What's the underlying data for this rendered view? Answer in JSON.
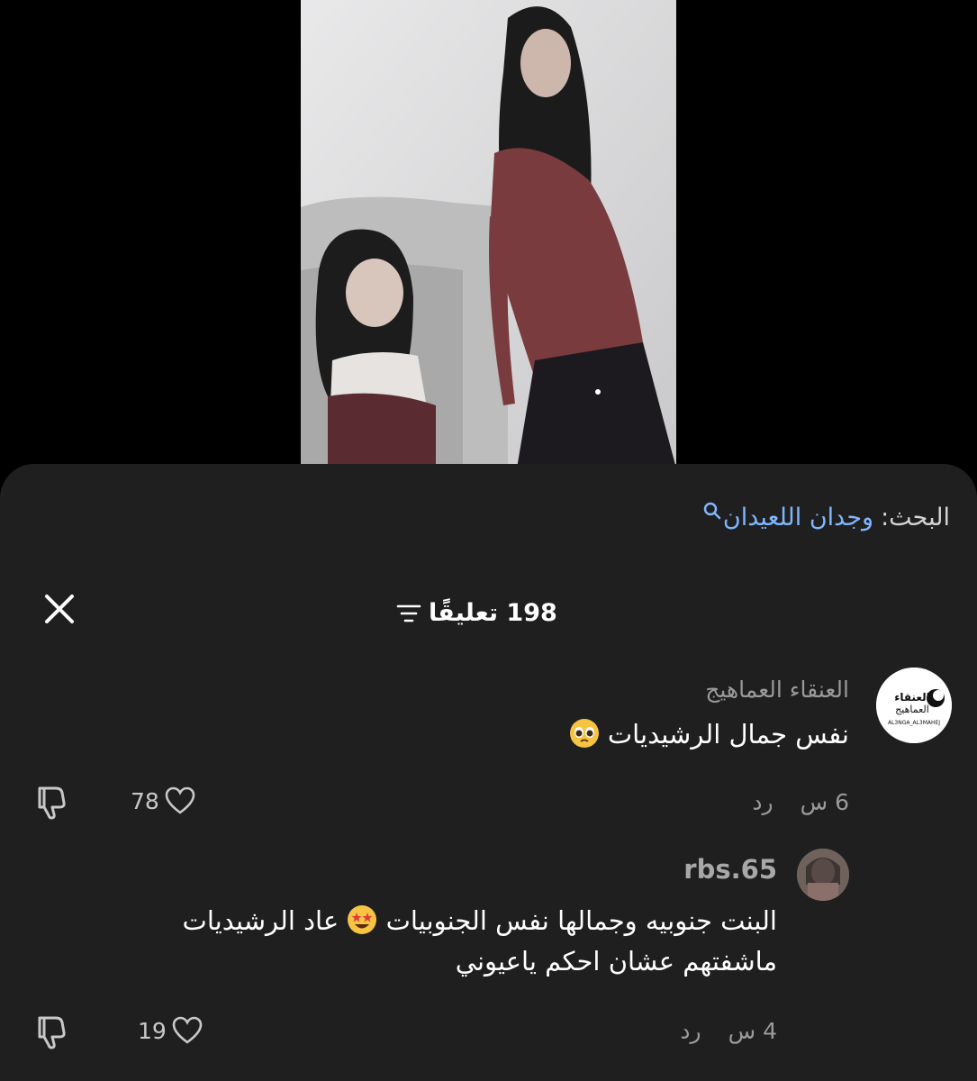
{
  "video": {
    "description_icon": "video-frame"
  },
  "search": {
    "prefix": "البحث:",
    "term": "وجدان اللعيدان",
    "icon": "search-icon"
  },
  "comments_header": {
    "count_label": "198 تعليقًا",
    "filter_icon": "filter-icon",
    "close_icon": "close-icon"
  },
  "comments": [
    {
      "author": "العنقاء العماهيج",
      "avatar_text": "العنقاء العماهيج",
      "avatar_subtext": "AL3NGA_AL3MAHEJ",
      "text": "نفس جمال الرشيديات",
      "emoji": "pleading-face",
      "time": "6 س",
      "reply_label": "رد",
      "likes": "78"
    },
    {
      "author": "rbs.65",
      "text_line1": "البنت جنوبيه وجمالها نفس الجنوبيات",
      "emoji": "star-struck",
      "text_line1b": "عاد الرشيديات",
      "text_line2": "ماشفتهم عشان احكم ياعيوني",
      "time": "4 س",
      "reply_label": "رد",
      "likes": "19"
    }
  ],
  "colors": {
    "sheet_bg": "#1f1f1f",
    "link": "#7fb6ff",
    "muted": "#9a9a9a"
  }
}
